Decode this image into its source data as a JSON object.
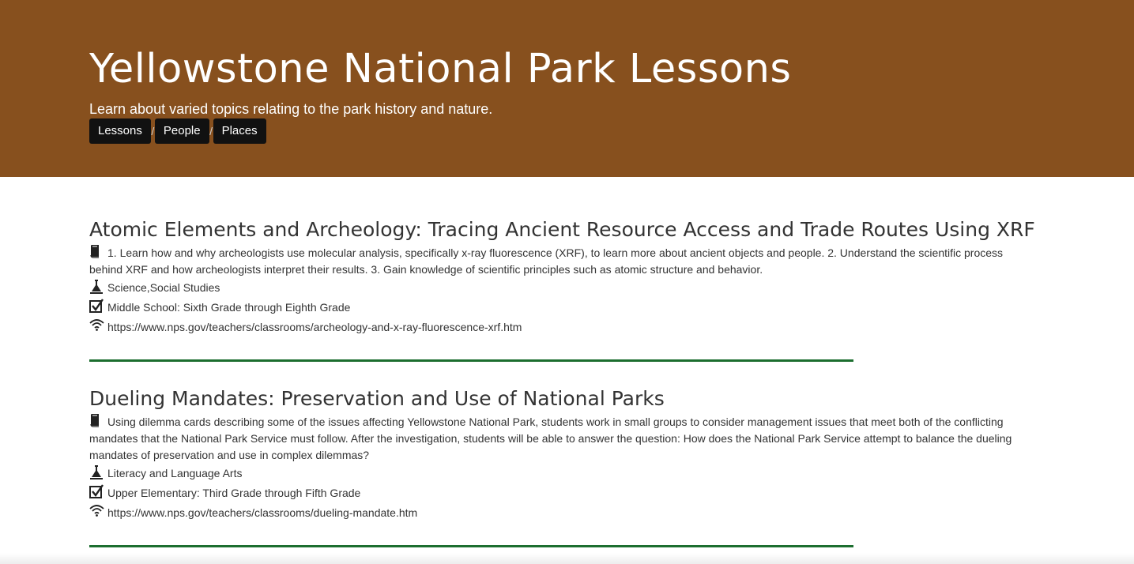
{
  "header": {
    "title": "Yellowstone National Park Lessons",
    "subtitle": "Learn about varied topics relating to the park history and nature.",
    "nav": [
      {
        "label": "Lessons"
      },
      {
        "label": "People"
      },
      {
        "label": "Places"
      }
    ],
    "nav_separator": "/"
  },
  "colors": {
    "header_background": "#87501e",
    "nav_button_background": "#111111",
    "divider": "#1c6e2f"
  },
  "icons": {
    "description": "book-icon",
    "subject": "flask-icon",
    "grade": "checkbox-icon",
    "url": "wifi-icon"
  },
  "lessons": [
    {
      "title": "Atomic Elements and Archeology: Tracing Ancient Resource Access and Trade Routes Using XRF",
      "description": "1. Learn how and why archeologists use molecular analysis, specifically x-ray fluorescence (XRF), to learn more about ancient objects and people. 2. Understand the scientific process behind XRF and how archeologists interpret their results. 3. Gain knowledge of scientific principles such as atomic structure and behavior.",
      "subject": "Science,Social Studies",
      "grade": "Middle School: Sixth Grade through Eighth Grade",
      "url": "https://www.nps.gov/teachers/classrooms/archeology-and-x-ray-fluorescence-xrf.htm"
    },
    {
      "title": "Dueling Mandates: Preservation and Use of National Parks",
      "description": "Using dilemma cards describing some of the issues affecting Yellowstone National Park, students work in small groups to consider management issues that meet both of the conflicting mandates that the National Park Service must follow. After the investigation, students will be able to answer the question: How does the National Park Service attempt to balance the dueling mandates of preservation and use in complex dilemmas?",
      "subject": "Literacy and Language Arts",
      "grade": "Upper Elementary: Third Grade through Fifth Grade",
      "url": "https://www.nps.gov/teachers/classrooms/dueling-mandate.htm"
    }
  ]
}
